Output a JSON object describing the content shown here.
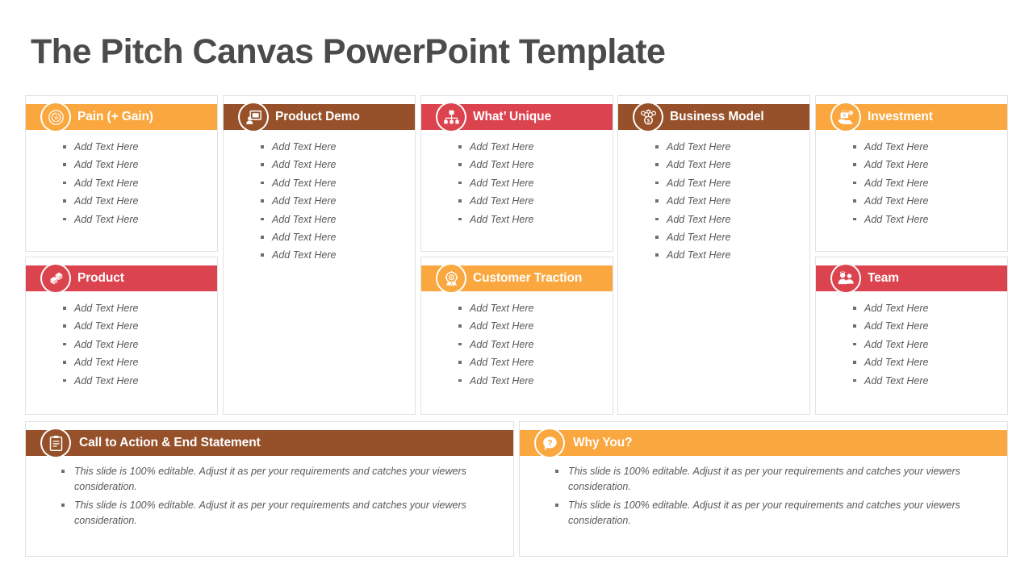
{
  "slide": {
    "title": "The Pitch Canvas PowerPoint Template"
  },
  "colors": {
    "orange": "#f9a73e",
    "red": "#db434e",
    "brown": "#96512a",
    "title_gray": "#4b4b4b",
    "body_gray": "#58595b",
    "card_border": "#e2e2e2"
  },
  "bullet_texts": {
    "add_text": "Add Text Here",
    "editable": "This slide is 100% editable. Adjust it as per your requirements and catches your viewers consideration."
  },
  "cards": [
    {
      "id": "pain-gain",
      "title": "Pain (+ Gain)",
      "color": "orange",
      "icon": "target-bolt-icon",
      "bullets": [
        "Add Text Here",
        "Add Text Here",
        "Add Text Here",
        "Add Text Here",
        "Add Text Here"
      ]
    },
    {
      "id": "product-demo",
      "title": "Product Demo",
      "color": "brown",
      "icon": "presentation-person-icon",
      "bullets": [
        "Add Text Here",
        "Add Text Here",
        "Add Text Here",
        "Add Text Here",
        "Add Text Here",
        "Add Text Here",
        "Add Text Here"
      ]
    },
    {
      "id": "whats-unique",
      "title": "What’ Unique",
      "color": "red",
      "icon": "org-chart-icon",
      "bullets": [
        "Add Text Here",
        "Add Text Here",
        "Add Text Here",
        "Add Text Here",
        "Add Text Here"
      ]
    },
    {
      "id": "business-model",
      "title": "Business Model",
      "color": "brown",
      "icon": "money-network-icon",
      "bullets": [
        "Add Text Here",
        "Add Text Here",
        "Add Text Here",
        "Add Text Here",
        "Add Text Here",
        "Add Text Here",
        "Add Text Here"
      ]
    },
    {
      "id": "investment",
      "title": "Investment",
      "color": "orange",
      "icon": "hand-money-icon",
      "bullets": [
        "Add Text Here",
        "Add Text Here",
        "Add Text Here",
        "Add Text Here",
        "Add Text Here"
      ]
    },
    {
      "id": "product",
      "title": "Product",
      "color": "red",
      "icon": "boxes-icon",
      "bullets": [
        "Add Text Here",
        "Add Text Here",
        "Add Text Here",
        "Add Text Here",
        "Add Text Here"
      ]
    },
    {
      "id": "customer-traction",
      "title": "Customer Traction",
      "color": "orange",
      "icon": "award-badge-icon",
      "bullets": [
        "Add Text Here",
        "Add Text Here",
        "Add Text Here",
        "Add Text Here",
        "Add Text Here"
      ]
    },
    {
      "id": "team",
      "title": "Team",
      "color": "red",
      "icon": "people-group-icon",
      "bullets": [
        "Add Text Here",
        "Add Text Here",
        "Add Text Here",
        "Add Text Here",
        "Add Text Here"
      ]
    },
    {
      "id": "call-to-action",
      "title": "Call to Action & End Statement",
      "color": "brown",
      "icon": "clipboard-icon",
      "bullets": [
        "This slide is 100% editable. Adjust it as per your requirements and catches your viewers consideration.",
        "This slide is 100% editable. Adjust it as per your requirements and catches your viewers consideration."
      ]
    },
    {
      "id": "why-you",
      "title": "Why You?",
      "color": "orange",
      "icon": "question-bubble-icon",
      "bullets": [
        "This slide is 100% editable. Adjust it as per your requirements and catches your viewers consideration.",
        "This slide is 100% editable. Adjust it as per your requirements and catches your viewers consideration."
      ]
    }
  ]
}
